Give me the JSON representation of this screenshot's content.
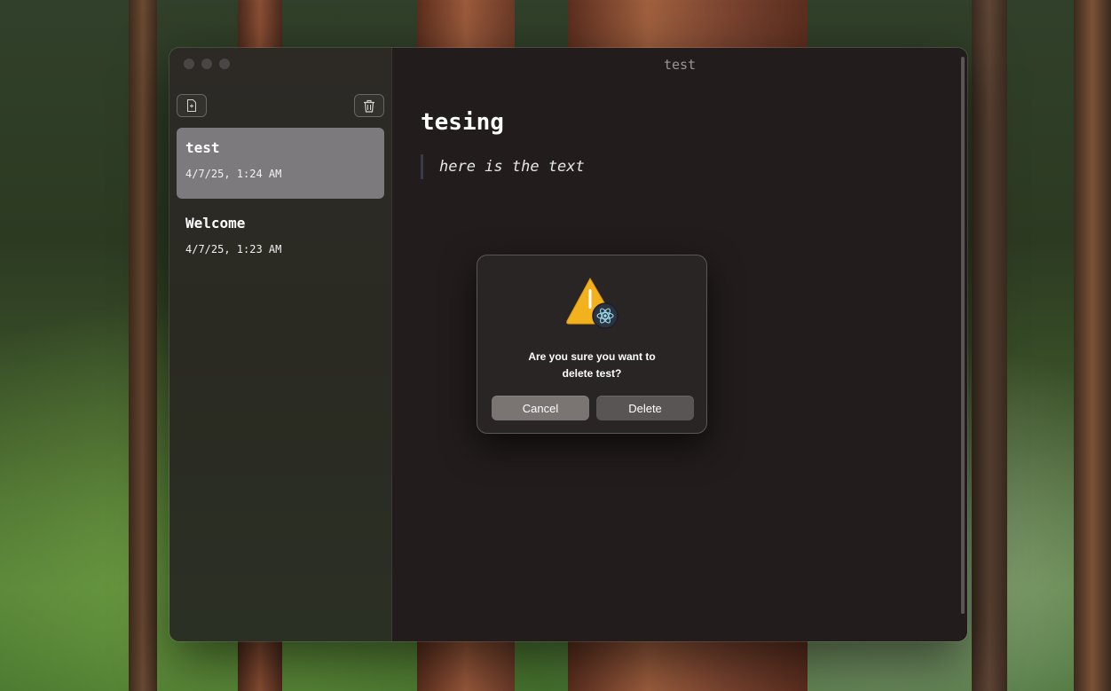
{
  "window": {
    "title": "test"
  },
  "sidebar": {
    "new_note_icon": "new-note-icon",
    "delete_icon": "trash-icon",
    "notes": [
      {
        "title": "test",
        "date": "4/7/25, 1:24 AM",
        "selected": true
      },
      {
        "title": "Welcome",
        "date": "4/7/25, 1:23 AM",
        "selected": false
      }
    ]
  },
  "editor": {
    "heading": "tesing",
    "blockquote": "here is the text"
  },
  "dialog": {
    "icon": "warning-icon",
    "badge_icon": "electron-icon",
    "message_line1": "Are you sure you want to",
    "message_line2": "delete test?",
    "cancel_label": "Cancel",
    "delete_label": "Delete"
  },
  "colors": {
    "selected_item": "#7d7a7d",
    "window_bg": "#221d1c",
    "warning": "#f2b21d"
  }
}
